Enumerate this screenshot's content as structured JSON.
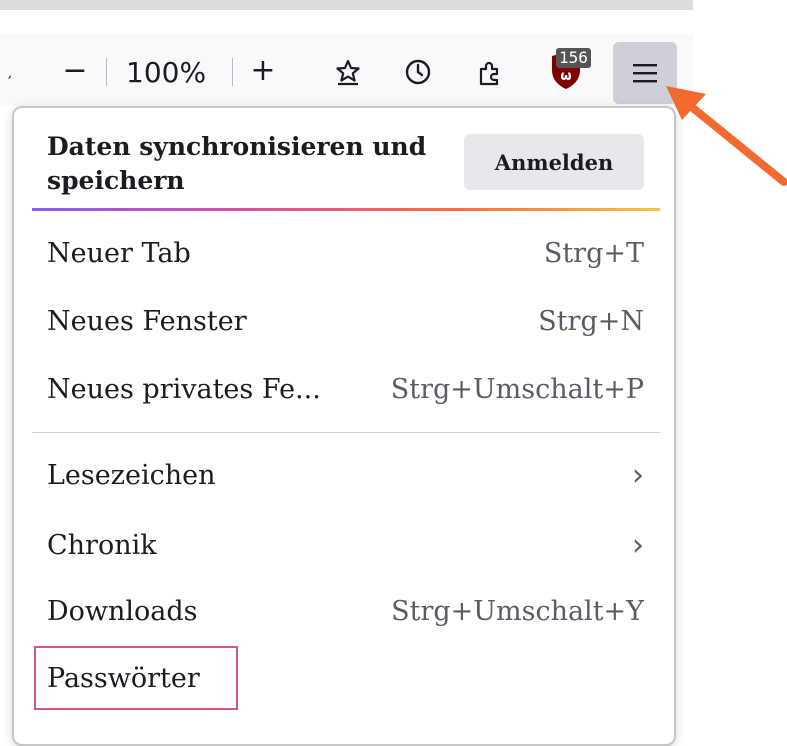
{
  "toolbar": {
    "zoom_out_label": "−",
    "zoom_value": "100%",
    "zoom_in_label": "+",
    "extension_badge": "156"
  },
  "sync": {
    "title": "Daten synchronisieren und speichern",
    "signin_label": "Anmelden"
  },
  "menu": {
    "items": [
      {
        "label": "Neuer Tab",
        "shortcut": "Strg+T"
      },
      {
        "label": "Neues Fenster",
        "shortcut": "Strg+N"
      },
      {
        "label": "Neues privates Fe...",
        "shortcut": "Strg+Umschalt+P"
      },
      {
        "label": "Lesezeichen",
        "shortcut": "›"
      },
      {
        "label": "Chronik",
        "shortcut": "›"
      },
      {
        "label": "Downloads",
        "shortcut": "Strg+Umschalt+Y"
      },
      {
        "label": "Passwörter",
        "shortcut": ""
      }
    ]
  },
  "colors": {
    "highlight_border": "#d4548a",
    "annotation_arrow": "#f26a2e",
    "menu_button_active": "#cfcfd8"
  }
}
